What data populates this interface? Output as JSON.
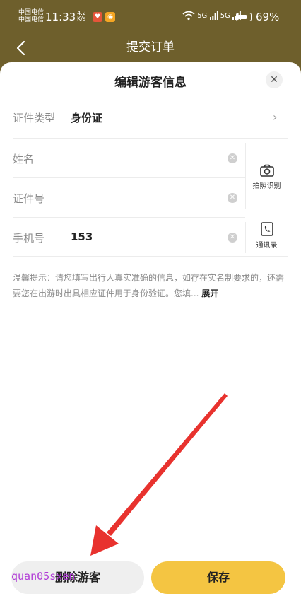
{
  "status_bar": {
    "carrier_1": "中国电信",
    "carrier_2": "中国电信",
    "time": "11:33",
    "net_speed_value": "4.2",
    "net_speed_unit": "K/s",
    "signal_1": "5G",
    "signal_2": "5G",
    "battery": "69%"
  },
  "header": {
    "title": "提交订单"
  },
  "sheet": {
    "title": "编辑游客信息",
    "close_symbol": "✕",
    "fields": [
      {
        "label": "证件类型",
        "value": "身份证"
      },
      {
        "label": "姓名",
        "value": ""
      },
      {
        "label": "证件号",
        "value": ""
      },
      {
        "label": "手机号",
        "value": "153"
      }
    ],
    "photo_recognize_label": "拍照识别",
    "contacts_label": "通讯录",
    "tip_text": "温馨提示：请您填写出行人真实准确的信息，如存在实名制要求的，还需要您在出游时出具相应证件用于身份验证。您填...",
    "tip_expand": "展开"
  },
  "buttons": {
    "delete_label": "删除游客",
    "save_label": "保存"
  },
  "watermark": "quan05sxen",
  "colors": {
    "header_bg": "#6e5f2c",
    "save_button": "#f4c542",
    "annotation_arrow": "#e8322e"
  }
}
